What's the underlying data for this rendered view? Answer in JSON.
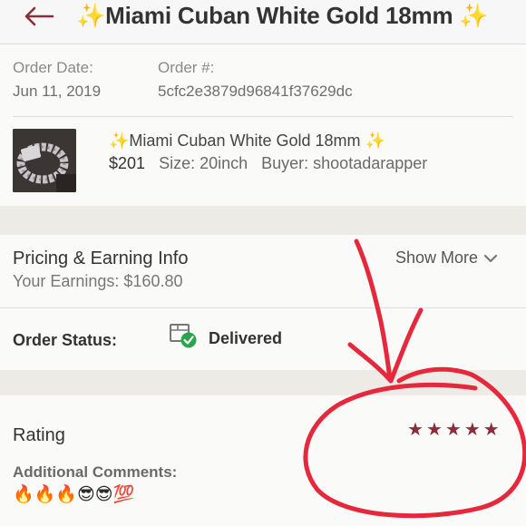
{
  "header": {
    "title": "✨Miami Cuban White Gold 18mm ✨"
  },
  "order": {
    "date_label": "Order Date:",
    "date_value": "Jun 11, 2019",
    "number_label": "Order #:",
    "number_value": "5cfc2e3879d96841f37629dc"
  },
  "product": {
    "title": "✨Miami Cuban White Gold 18mm ✨",
    "price": "$201",
    "size": "Size: 20inch",
    "buyer": "Buyer: shootadarapper"
  },
  "pricing": {
    "title": "Pricing & Earning Info",
    "earnings": "Your Earnings: $160.80",
    "show_more": "Show More"
  },
  "status": {
    "label": "Order Status:",
    "value": "Delivered"
  },
  "rating": {
    "label": "Rating",
    "stars": 5,
    "max_stars": 5,
    "star_color": "#8a2e3c",
    "comments_label": "Additional Comments:",
    "comments": "🔥🔥🔥😎😎💯"
  },
  "colors": {
    "accent": "#8a2e3c",
    "annotation": "#e5283c",
    "delivered_check": "#2aa44f"
  }
}
